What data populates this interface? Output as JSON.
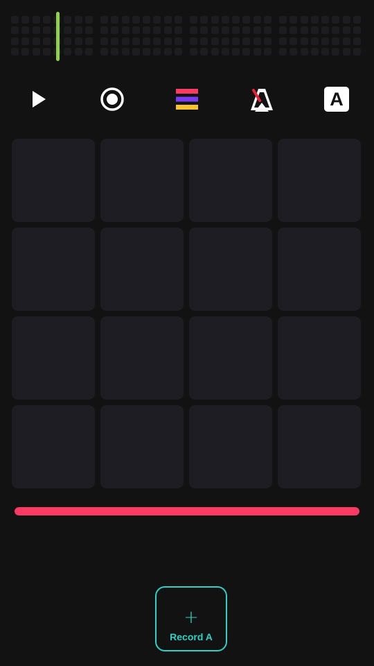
{
  "colors": {
    "background": "#121212",
    "sequencer_cell": "#1d1d20",
    "playhead": "#8fd14f",
    "pad": "#1e1d24",
    "level_fill": "#fb3b63",
    "record_accent": "#2ed1c6",
    "tempo_stripes": [
      "#fb3b63",
      "#7b3bf2",
      "#f7c22d"
    ]
  },
  "sequencer": {
    "groups": 4,
    "rows_per_group": 4,
    "cols_per_group": 8,
    "playhead_step": 4
  },
  "toolbar": {
    "play_icon": "play-icon",
    "record_icon": "record-icon",
    "tempo_icon": "tempo-bars-icon",
    "metronome_icon": "metronome-off-icon",
    "bank_label": "A"
  },
  "pads": {
    "count": 16,
    "columns": 4
  },
  "level": {
    "fill_fraction": 1.0
  },
  "record_button": {
    "icon": "plus-icon",
    "plus_glyph": "+",
    "label": "Record A"
  }
}
